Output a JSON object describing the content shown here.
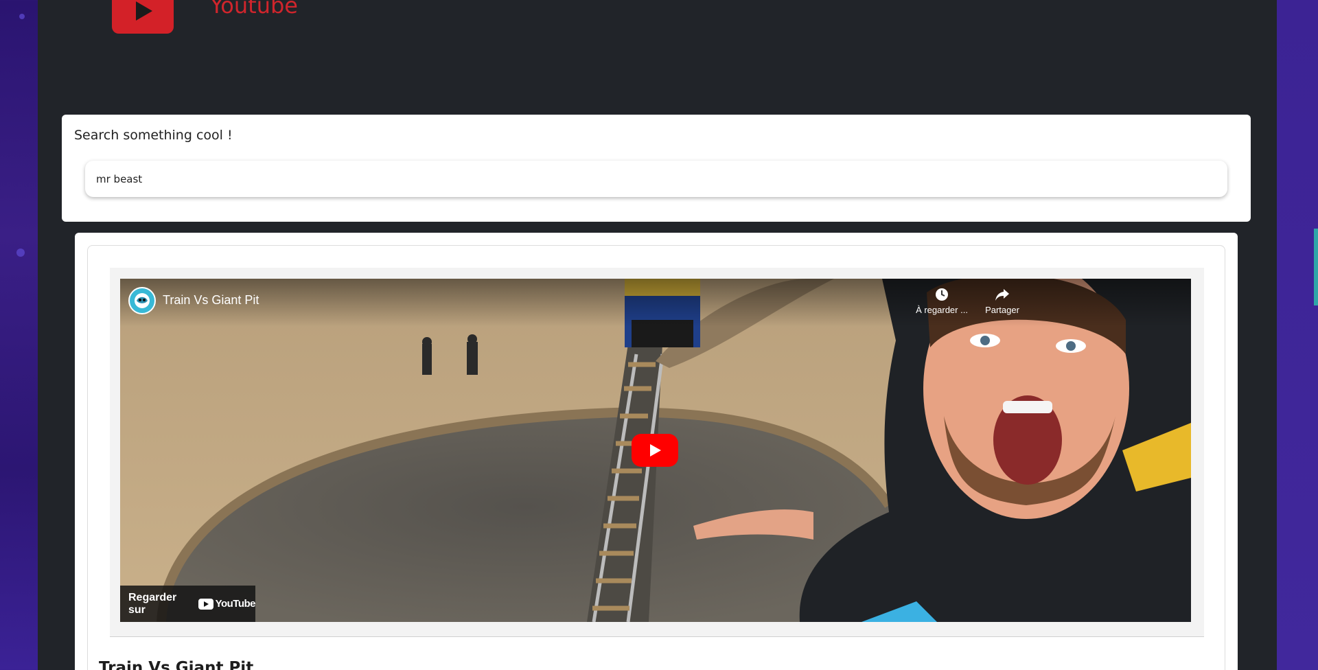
{
  "header": {
    "brand": "Youtube",
    "logo_icon": "youtube-play-icon"
  },
  "search": {
    "label": "Search something cool !",
    "value": "mr beast",
    "placeholder": ""
  },
  "results": [
    {
      "player": {
        "title": "Train Vs Giant Pit",
        "channel_icon": "channel-avatar-icon",
        "watch_later_label": "À regarder ...",
        "share_label": "Partager",
        "watch_on_label": "Regarder sur",
        "watch_on_brand": "YouTube"
      },
      "title": "Train Vs Giant Pit"
    }
  ],
  "colors": {
    "app_bg": "#212429",
    "brand_red": "#d0252c",
    "play_red": "#ff0000",
    "card_bg": "#ffffff",
    "page_bg": "#2a1470"
  }
}
